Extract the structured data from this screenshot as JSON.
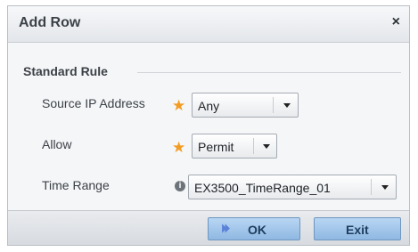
{
  "dialog": {
    "title": "Add Row",
    "close_label": "×"
  },
  "section": {
    "title": "Standard Rule"
  },
  "fields": {
    "source_ip": {
      "label": "Source IP Address",
      "value": "Any",
      "required_mark": "★"
    },
    "allow": {
      "label": "Allow",
      "value": "Permit",
      "required_mark": "★"
    },
    "time_range": {
      "label": "Time Range",
      "value": "EX3500_TimeRange_01",
      "info_mark": "i"
    }
  },
  "footer": {
    "ok_label": "OK",
    "ok_icon": "⏵⏵",
    "exit_label": "Exit"
  },
  "colors": {
    "required_star": "#f39c23",
    "button_fill": "#a3c6ea",
    "text": "#3c4148"
  },
  "icons": {
    "close": "close-icon",
    "required": "star-icon",
    "info": "info-icon",
    "dropdown": "chevron-down-icon",
    "ok": "play-icon"
  }
}
